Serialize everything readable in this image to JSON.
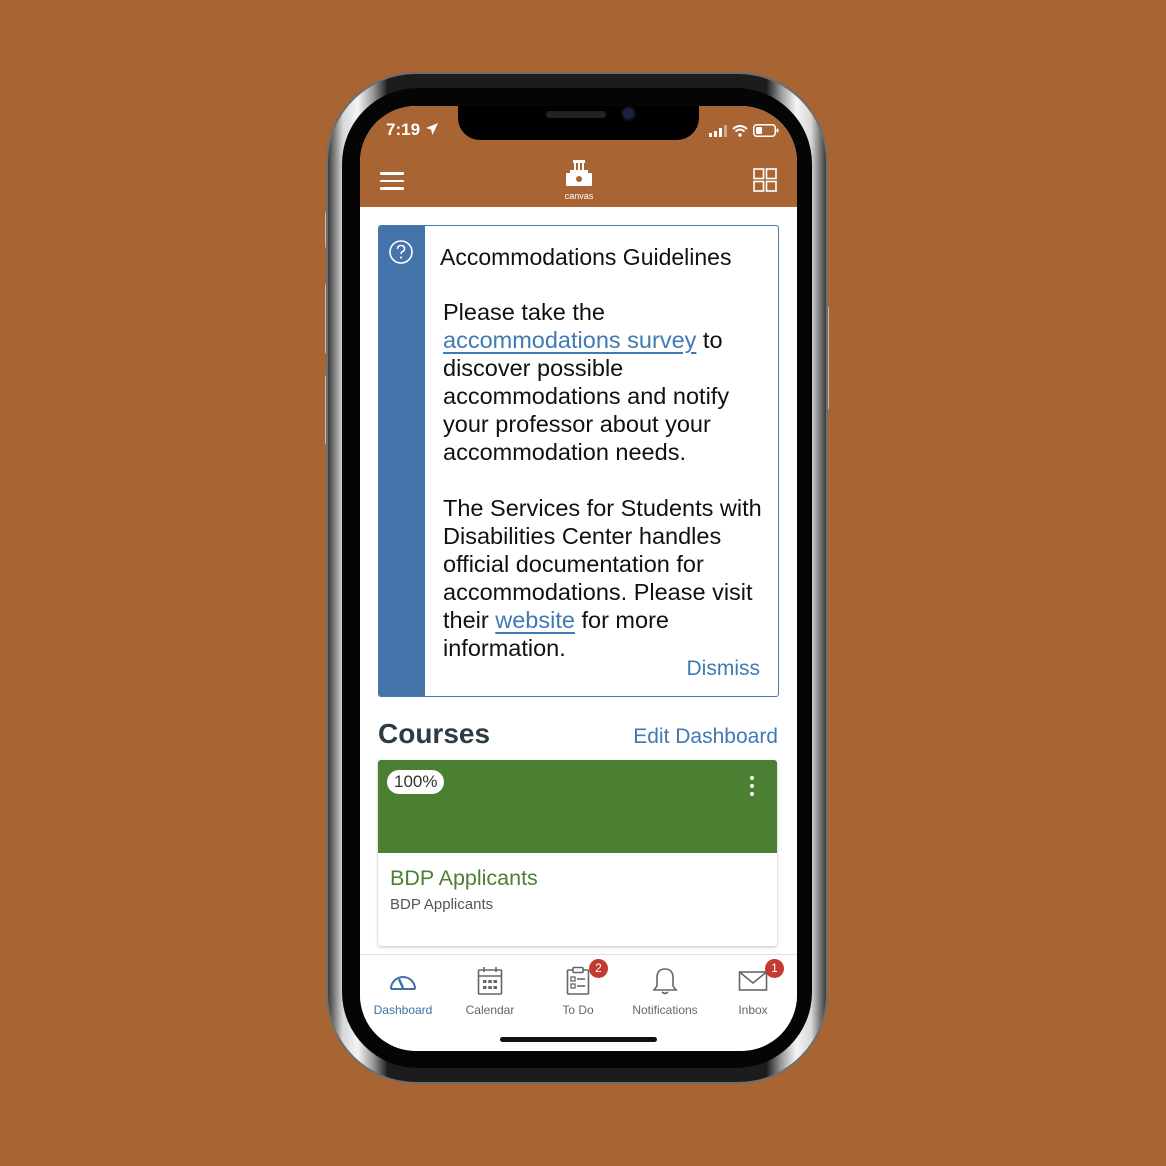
{
  "status": {
    "time": "7:19"
  },
  "header": {
    "logo_text": "canvas"
  },
  "notice": {
    "title": "Accommodations Guidelines",
    "p1_before": "Please take the ",
    "p1_link": "accommodations survey",
    "p1_after": " to discover possible accommodations and notify your professor about your accommodation needs.",
    "p2_before": "The Services for Students with Disabilities Center handles official documentation for accommodations. Please visit their ",
    "p2_link": "website",
    "p2_after": " for more information.",
    "dismiss": "Dismiss"
  },
  "courses": {
    "title": "Courses",
    "edit": "Edit Dashboard",
    "items": [
      {
        "percent": "100%",
        "name": "BDP Applicants",
        "code": "BDP Applicants",
        "color": "#4b7f31"
      }
    ]
  },
  "tabs": [
    {
      "label": "Dashboard",
      "icon": "dashboard-gauge-icon",
      "badge": null
    },
    {
      "label": "Calendar",
      "icon": "calendar-icon",
      "badge": null
    },
    {
      "label": "To Do",
      "icon": "todo-clipboard-icon",
      "badge": "2"
    },
    {
      "label": "Notifications",
      "icon": "bell-icon",
      "badge": null
    },
    {
      "label": "Inbox",
      "icon": "envelope-icon",
      "badge": "1"
    }
  ],
  "colors": {
    "brand": "#a86433",
    "accent": "#3f7ab5",
    "course": "#4b7f31"
  }
}
